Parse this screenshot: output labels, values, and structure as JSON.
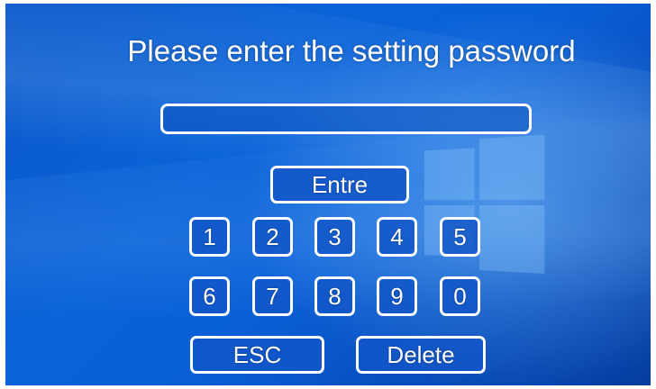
{
  "prompt": "Please enter the setting password",
  "password_value": "",
  "enter_label": "Entre",
  "keys_row1": [
    "1",
    "2",
    "3",
    "4",
    "5"
  ],
  "keys_row2": [
    "6",
    "7",
    "8",
    "9",
    "0"
  ],
  "esc_label": "ESC",
  "delete_label": "Delete",
  "colors": {
    "background": "#0a5fd6",
    "button_border": "#ffffff",
    "text": "#ffffff"
  }
}
